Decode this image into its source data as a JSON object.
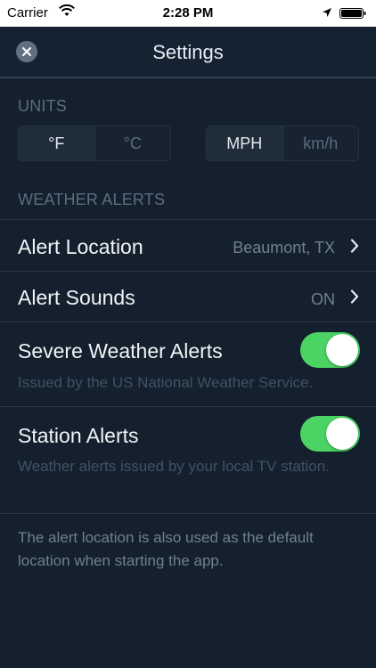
{
  "status_bar": {
    "carrier": "Carrier",
    "time": "2:28 PM"
  },
  "header": {
    "title": "Settings",
    "close_icon": "close-icon"
  },
  "units": {
    "section_label": "UNITS",
    "temperature": {
      "options": [
        "°F",
        "°C"
      ],
      "selected": "°F"
    },
    "speed": {
      "options": [
        "MPH",
        "km/h"
      ],
      "selected": "MPH"
    }
  },
  "weather_alerts": {
    "section_label": "WEATHER ALERTS",
    "alert_location": {
      "label": "Alert Location",
      "value": "Beaumont, TX"
    },
    "alert_sounds": {
      "label": "Alert Sounds",
      "value": "ON"
    },
    "severe_weather": {
      "label": "Severe Weather Alerts",
      "description": "Issued by the US National Weather Service.",
      "enabled": true
    },
    "station_alerts": {
      "label": "Station Alerts",
      "description": "Weather alerts issued by your local TV station.",
      "enabled": true
    }
  },
  "footer_note": "The alert location is also used as the default location when starting the app.",
  "colors": {
    "background": "#14202d",
    "toggle_on": "#4bd463",
    "muted_text": "#6f8090"
  }
}
